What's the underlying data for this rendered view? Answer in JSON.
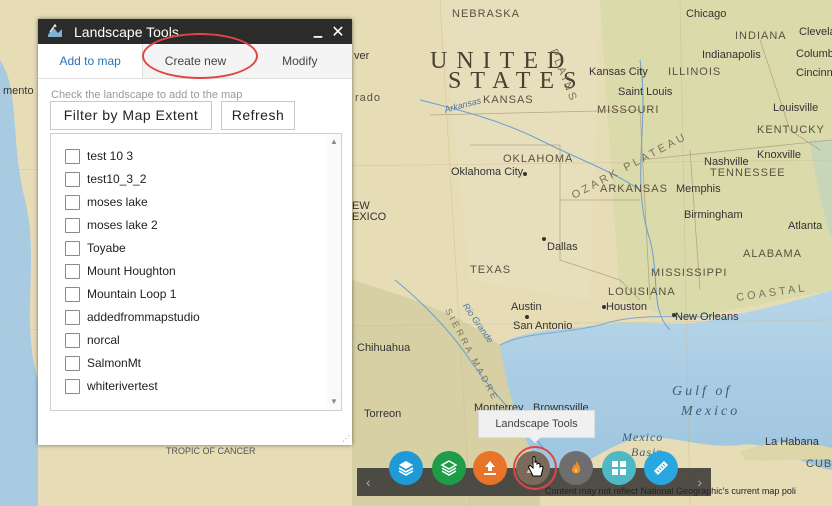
{
  "panel": {
    "title": "Landscape Tools",
    "minimize_glyph": "▁",
    "close_glyph": "✕",
    "tabs": [
      {
        "label": "Add to map"
      },
      {
        "label": "Create new"
      },
      {
        "label": "Modify"
      }
    ],
    "hint": "Check the landscape to add to the map",
    "filter_button": "Filter by Map Extent",
    "refresh_button": "Refresh",
    "items": [
      {
        "label": "test 10 3",
        "checked": false
      },
      {
        "label": "test10_3_2",
        "checked": false
      },
      {
        "label": "moses lake",
        "checked": false
      },
      {
        "label": "moses lake 2",
        "checked": false
      },
      {
        "label": "Toyabe",
        "checked": false
      },
      {
        "label": "Mount Houghton",
        "checked": false
      },
      {
        "label": "Mountain Loop 1",
        "checked": false
      },
      {
        "label": "addedfrommapstudio",
        "checked": false
      },
      {
        "label": "norcal",
        "checked": false
      },
      {
        "label": "SalmonMt",
        "checked": false
      },
      {
        "label": "whiterivertest",
        "checked": false
      }
    ]
  },
  "toolbar": {
    "tooltip": "Landscape Tools",
    "buttons": [
      {
        "icon": "layers-icon",
        "color": "#1e9bd7"
      },
      {
        "icon": "layer-stack-icon",
        "color": "#1f9c48"
      },
      {
        "icon": "upload-icon",
        "color": "#e8742a"
      },
      {
        "icon": "landscape-tools-icon",
        "color": "#7b6a5a"
      },
      {
        "icon": "fire-icon",
        "color": "#6e6e6e"
      },
      {
        "icon": "grid-icon",
        "color": "#4fb8c5"
      },
      {
        "icon": "ruler-icon",
        "color": "#29a7e0"
      }
    ]
  },
  "map": {
    "labels": {
      "nebraska": "NEBRASKA",
      "united": "UNITED",
      "states": "STATES",
      "kansas": "KANSAS",
      "kansas_city": "Kansas City",
      "missouri": "MISSOURI",
      "illinois": "ILLINOIS",
      "indiana": "INDIANA",
      "indianapolis": "Indianapolis",
      "chicago": "Chicago",
      "cleveland": "Clevelar",
      "columbus": "Columbu",
      "cincinnati": "Cincinna",
      "saint_louis": "Saint Louis",
      "louisville": "Louisville",
      "kentucky": "KENTUCKY",
      "nashville": "Nashville",
      "tennessee": "TENNESSEE",
      "knoxville": "Knoxville",
      "memphis": "Memphis",
      "oklahoma": "OKLAHOMA",
      "oklahoma_city": "Oklahoma City",
      "arkansas": "ARKANSAS",
      "arkansas_river": "Arkansas",
      "ozark": "OZARK PLATEAU",
      "plains": "PLAINS",
      "dallas": "Dallas",
      "texas": "TEXAS",
      "mississippi": "MISSISSIPPI",
      "birmingham": "Birmingham",
      "atlanta": "Atlanta",
      "alabama": "ALABAMA",
      "louisiana": "LOUISIANA",
      "coastal": "COASTAL",
      "austin": "Austin",
      "houston": "Houston",
      "san_antonio": "San Antonio",
      "new_orleans": "New Orleans",
      "chihuahua": "Chihuahua",
      "torreon": "Torreon",
      "monterrey": "Monterrey",
      "brownsville": "Brownsville",
      "gulf1": "Gulf of",
      "gulf2": "Mexico",
      "mexico_basin": "Mexico",
      "basin": "Basin",
      "la_habana": "La Habana",
      "cuba": "CUB",
      "tropic": "TROPIC OF CANCER",
      "sierra": "SIERRA MADRE",
      "rio_grande": "Rio Grande",
      "mexico_frag": "EW",
      "mexico_frag2": "EXICO",
      "colorado_frag": "ver",
      "mento": "mento",
      "rado": "rado"
    },
    "attribution": "Content may not reflect National Geographic's current map poli"
  }
}
